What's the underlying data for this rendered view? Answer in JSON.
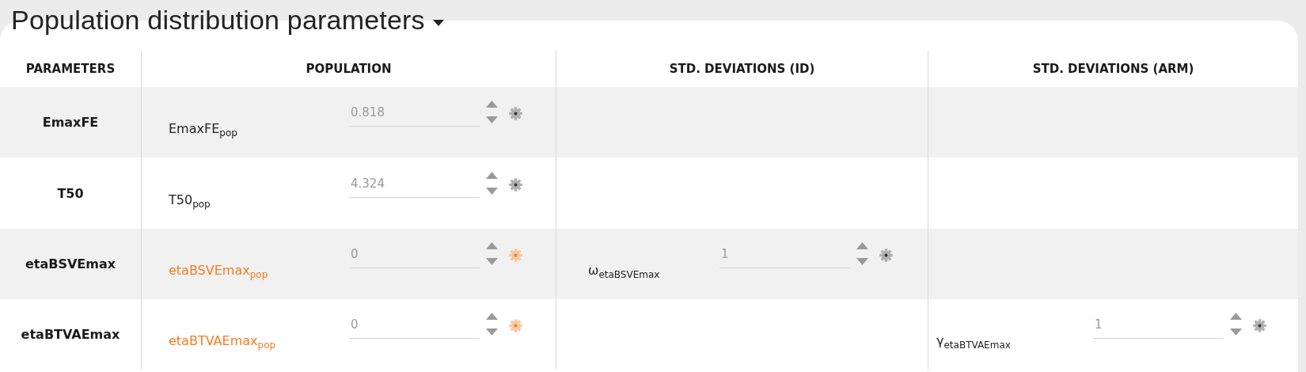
{
  "title": "Population distribution parameters",
  "columns": [
    "PARAMETERS",
    "POPULATION",
    "STD. DEVIATIONS (ID)",
    "STD. DEVIATIONS (ARM)"
  ],
  "rows": [
    {
      "name": "EmaxFE",
      "population": {
        "label": "EmaxFE$_{pop}$",
        "value": "0.818",
        "highlighted": false
      }
    },
    {
      "name": "T50",
      "population": {
        "label": "T50$_{pop}$",
        "value": "4.324",
        "highlighted": false
      }
    },
    {
      "name": "etaBSVEmax",
      "population": {
        "label": "etaBSVEmax$_{pop}$",
        "value": "0",
        "highlighted": true
      },
      "std_id": {
        "label": "ω$_{etaBSVEmax}$",
        "value": "1",
        "highlighted": false
      }
    },
    {
      "name": "etaBTVAEmax",
      "population": {
        "label": "etaBTVAEmax$_{pop}$",
        "value": "0",
        "highlighted": true
      },
      "std_arm": {
        "label": "γ$_{etaBTVAEmax}$",
        "value": "1",
        "highlighted": false
      }
    }
  ]
}
